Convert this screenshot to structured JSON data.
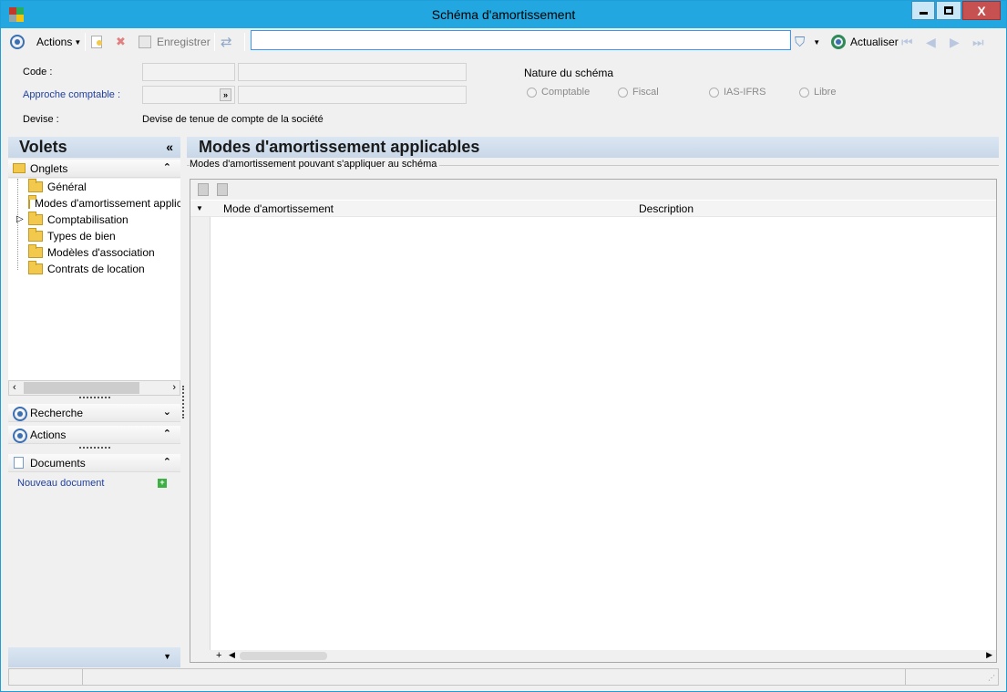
{
  "window": {
    "title": "Schéma d'amortissement",
    "controls": {
      "minimize": "▬",
      "maximize": "▢",
      "close": "X"
    }
  },
  "toolbar": {
    "actions_label": "Actions",
    "save_label": "Enregistrer",
    "refresh_label": "Actualiser",
    "search_value": ""
  },
  "form": {
    "code_label": "Code :",
    "approche_label": "Approche comptable :",
    "devise_label": "Devise :",
    "devise_value": "Devise de tenue de compte de la société",
    "nature_label": "Nature du schéma",
    "nature_options": [
      "Comptable",
      "Fiscal",
      "IAS-IFRS",
      "Libre"
    ]
  },
  "sidebar": {
    "title": "Volets",
    "onglets_label": "Onglets",
    "tree": [
      "Général",
      "Modes d'amortissement applicables",
      "Comptabilisation",
      "Types de bien",
      "Modèles d'association",
      "Contrats de location"
    ],
    "recherche_label": "Recherche",
    "actions_label": "Actions",
    "documents_label": "Documents",
    "nouveau_document_label": "Nouveau document"
  },
  "main": {
    "title": "Modes d'amortissement applicables",
    "group_label": "Modes d'amortissement pouvant s'appliquer au schéma",
    "columns": [
      "Mode d'amortissement",
      "Description"
    ],
    "rows": []
  },
  "colors": {
    "titlebar": "#22a7e0",
    "header_gradient": "#c8d7e8",
    "link": "#1f3fa0"
  }
}
